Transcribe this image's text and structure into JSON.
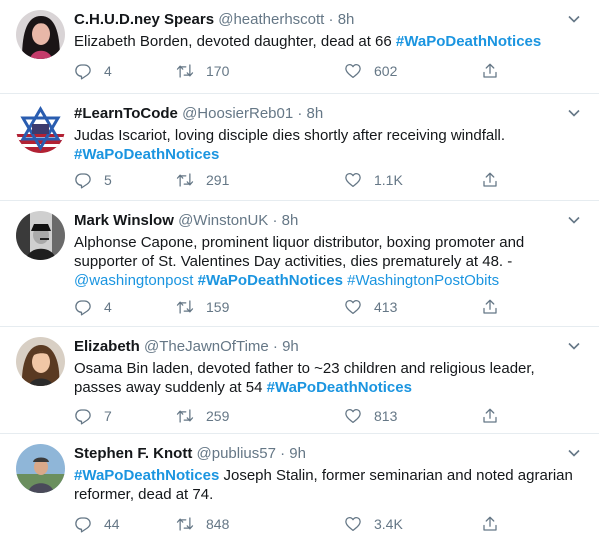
{
  "tweets": [
    {
      "name": "C.H.U.D.ney Spears",
      "handle": "@heatherhscott",
      "sep": "·",
      "time": "8h",
      "parts": [
        {
          "t": "Elizabeth Borden, devoted daughter, dead at 66 ",
          "c": "plain"
        },
        {
          "t": "#WaPoDeathNotices",
          "c": "hash"
        }
      ],
      "reply": "4",
      "retweet": "170",
      "like": "602"
    },
    {
      "name": "#LearnToCode",
      "handle": "@HoosierReb01",
      "sep": "·",
      "time": "8h",
      "parts": [
        {
          "t": "Judas Iscariot, loving disciple dies shortly after receiving windfall. ",
          "c": "plain"
        },
        {
          "t": "#WaPoDeathNotices",
          "c": "hash"
        }
      ],
      "reply": "5",
      "retweet": "291",
      "like": "1.1K"
    },
    {
      "name": "Mark Winslow",
      "handle": "@WinstonUK",
      "sep": "·",
      "time": "8h",
      "parts": [
        {
          "t": "Alphonse Capone, prominent liquor distributor, boxing promoter and supporter of St. Valentines Day activities, dies prematurely at 48. - ",
          "c": "plain"
        },
        {
          "t": "@washingtonpost",
          "c": "link"
        },
        {
          "t": " ",
          "c": "plain"
        },
        {
          "t": "#WaPoDeathNotices",
          "c": "hash"
        },
        {
          "t": " ",
          "c": "plain"
        },
        {
          "t": "#WashingtonPostObits",
          "c": "link"
        }
      ],
      "reply": "4",
      "retweet": "159",
      "like": "413"
    },
    {
      "name": "Elizabeth",
      "handle": "@TheJawnOfTime",
      "sep": "·",
      "time": "9h",
      "parts": [
        {
          "t": "Osama Bin laden, devoted father to ~23 children and religious leader, passes away suddenly at 54 ",
          "c": "plain"
        },
        {
          "t": "#WaPoDeathNotices",
          "c": "hash"
        }
      ],
      "reply": "7",
      "retweet": "259",
      "like": "813"
    },
    {
      "name": "Stephen F. Knott",
      "handle": "@publius57",
      "sep": "·",
      "time": "9h",
      "parts": [
        {
          "t": "#WaPoDeathNotices",
          "c": "hash"
        },
        {
          "t": " Joseph Stalin, former seminarian and noted agrarian reformer, dead at 74.",
          "c": "plain"
        }
      ],
      "reply": "44",
      "retweet": "848",
      "like": "3.4K"
    }
  ],
  "icons": {
    "reply": "reply-icon",
    "retweet": "retweet-icon",
    "like": "like-icon",
    "share": "share-icon",
    "caret": "chevron-down-icon"
  },
  "colors": {
    "link": "#1b95e0",
    "muted": "#657786",
    "text": "#14171a",
    "divider": "#e6ecf0"
  }
}
